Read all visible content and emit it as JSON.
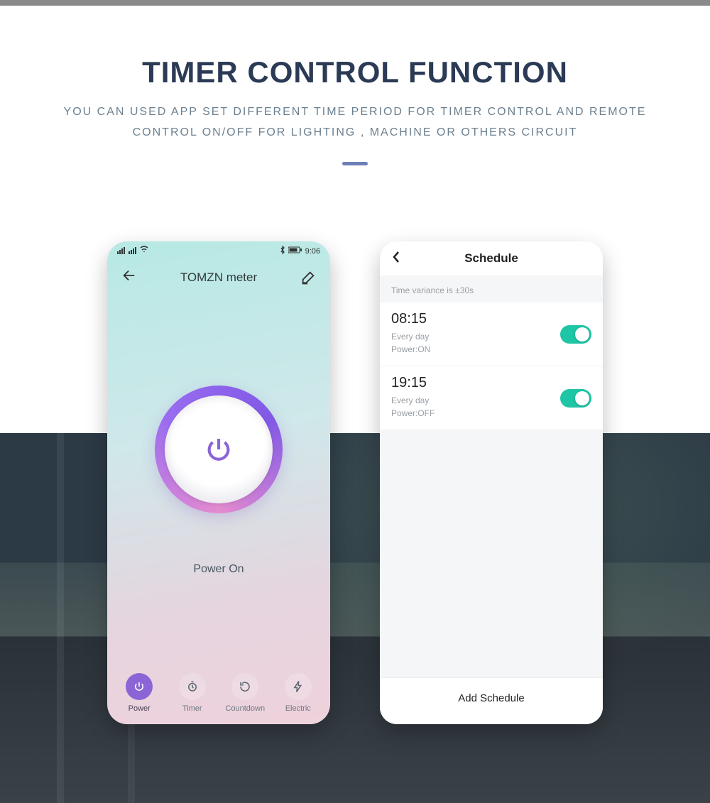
{
  "hero": {
    "title": "TIMER CONTROL FUNCTION",
    "subtitle": "YOU CAN USED APP SET DIFFERENT TIME PERIOD FOR TIMER CONTROL AND REMOTE CONTROL ON/OFF FOR LIGHTING , MACHINE OR OTHERS CIRCUIT"
  },
  "phone1": {
    "status_time": "9:06",
    "app_title": "TOMZN meter",
    "power_label": "Power On",
    "tabs": [
      {
        "label": "Power"
      },
      {
        "label": "Timer"
      },
      {
        "label": "Countdown"
      },
      {
        "label": "Electric"
      }
    ]
  },
  "phone2": {
    "title": "Schedule",
    "note": "Time variance is ±30s",
    "items": [
      {
        "time": "08:15",
        "repeat": "Every day",
        "action": "Power:ON"
      },
      {
        "time": "19:15",
        "repeat": "Every day",
        "action": "Power:OFF"
      }
    ],
    "add_label": "Add Schedule"
  }
}
